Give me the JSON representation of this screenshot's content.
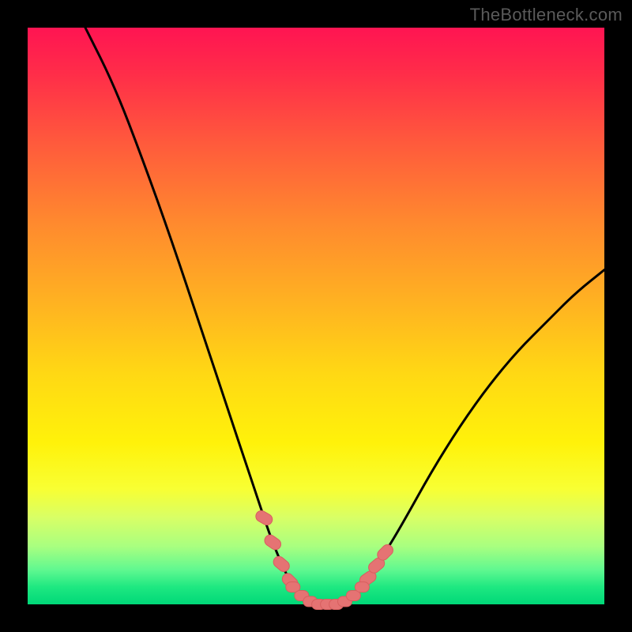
{
  "watermark": "TheBottleneck.com",
  "colors": {
    "frame": "#000000",
    "curve": "#000000",
    "marker_fill": "#e57373",
    "marker_stroke": "#d85f5f"
  },
  "chart_data": {
    "type": "line",
    "title": "",
    "xlabel": "",
    "ylabel": "",
    "xlim": [
      0,
      100
    ],
    "ylim": [
      0,
      100
    ],
    "note": "Bottleneck V-curve; y≈100 far from optimum, y≈0 at optimum range ~x=45–58",
    "x": [
      10,
      15,
      20,
      25,
      30,
      35,
      38,
      40,
      42,
      44,
      46,
      48,
      50,
      52,
      54,
      56,
      58,
      60,
      62,
      65,
      70,
      75,
      80,
      85,
      90,
      95,
      100
    ],
    "values": [
      100,
      90,
      77,
      63,
      48,
      33,
      24,
      18,
      12,
      7,
      3,
      1,
      0,
      0,
      0,
      1,
      3,
      6,
      9,
      14,
      23,
      31,
      38,
      44,
      49,
      54,
      58
    ],
    "markers": {
      "left_cluster_x": [
        41,
        42.5,
        44,
        45.5
      ],
      "right_cluster_x": [
        59,
        60.5,
        62
      ],
      "bottom_band_x": [
        46,
        47.5,
        49,
        50.5,
        52,
        53.5,
        55,
        56.5,
        58
      ]
    }
  }
}
